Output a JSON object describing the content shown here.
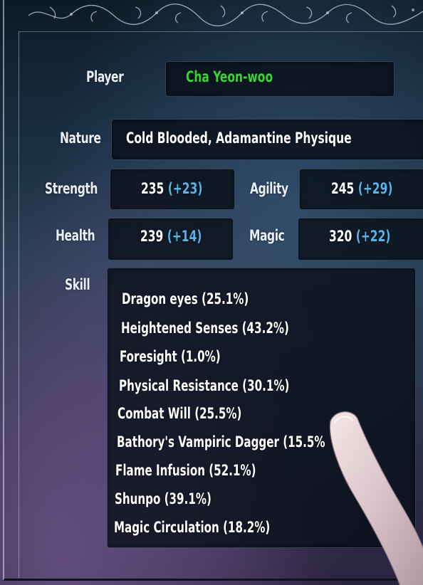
{
  "player": {
    "label": "Player",
    "name": "Cha Yeon-woo"
  },
  "nature": {
    "label": "Nature",
    "value": "Cold Blooded, Adamantine Physique"
  },
  "stats": {
    "strength": {
      "label": "Strength",
      "base": "235",
      "bonus": "(+23)"
    },
    "agility": {
      "label": "Agility",
      "base": "245",
      "bonus": "(+29)"
    },
    "health": {
      "label": "Health",
      "base": "239",
      "bonus": "(+14)"
    },
    "magic": {
      "label": "Magic",
      "base": "320",
      "bonus": "(+22)"
    }
  },
  "skill": {
    "label": "Skill",
    "items": [
      "Dragon eyes (25.1%)",
      "Heightened Senses (43.2%)",
      "Foresight (1.0%)",
      "Physical Resistance (30.1%)",
      "Combat Will (25.5%)",
      "Bathory's Vampiric Dagger (15.5%",
      "Flame Infusion (52.1%)",
      "Shunpo (39.1%)",
      "Magic Circulation (18.2%)"
    ]
  },
  "colors": {
    "player_name": "#38d438",
    "bonus": "#58b4e8",
    "text": "#ffffff",
    "label": "#e8eef6"
  }
}
